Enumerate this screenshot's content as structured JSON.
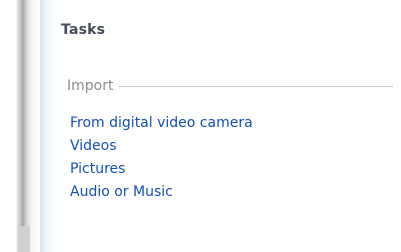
{
  "pane": {
    "title": "Tasks"
  },
  "import_group": {
    "label": "Import",
    "links": [
      {
        "label": "From digital video camera"
      },
      {
        "label": "Videos"
      },
      {
        "label": "Pictures"
      },
      {
        "label": "Audio or Music"
      }
    ]
  },
  "colors": {
    "link": "#1650a6",
    "group_header": "#8d8d8d",
    "title": "#444d57"
  }
}
